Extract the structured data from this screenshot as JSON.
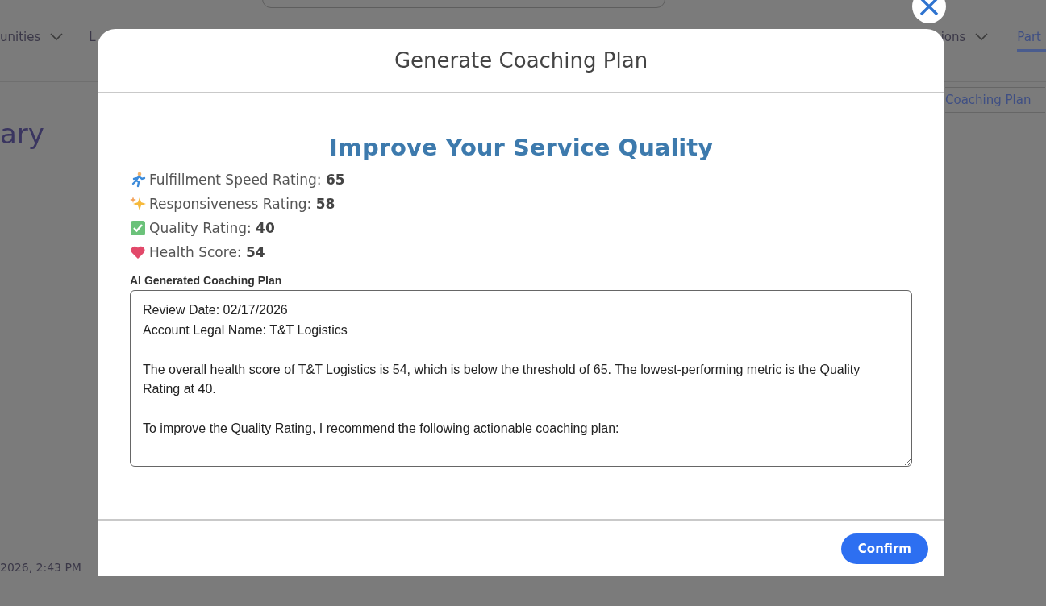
{
  "background": {
    "nav_tabs": [
      {
        "label": "unities",
        "has_menu": true,
        "selected": false
      },
      {
        "label": "L",
        "has_menu": false,
        "selected": false
      },
      {
        "label": "ions",
        "has_menu": true,
        "selected": false
      },
      {
        "label": "Part",
        "has_menu": false,
        "selected": true
      }
    ],
    "page_title": "ary",
    "coaching_plan_button": "Coaching Plan",
    "timestamp": "2026, 2:43 PM"
  },
  "dialog": {
    "title": "Generate Coaching Plan",
    "heading": "Improve Your Service Quality",
    "metrics": [
      {
        "kind": "runner",
        "label": "Fulfillment Speed Rating:",
        "value": "65"
      },
      {
        "kind": "sparkles",
        "label": "Responsiveness Rating:",
        "value": "58"
      },
      {
        "kind": "check",
        "label": "Quality Rating:",
        "value": "40"
      },
      {
        "kind": "heart",
        "label": "Health Score:",
        "value": "54"
      }
    ],
    "plan_label": "AI Generated Coaching Plan",
    "plan_text": "Review Date: 02/17/2026\nAccount Legal Name: T&T Logistics\n\nThe overall health score of T&T Logistics is 54, which is below the threshold of 65. The lowest-performing metric is the Quality Rating at 40.\n\nTo improve the Quality Rating, I recommend the following actionable coaching plan:",
    "confirm_button": "Confirm"
  }
}
